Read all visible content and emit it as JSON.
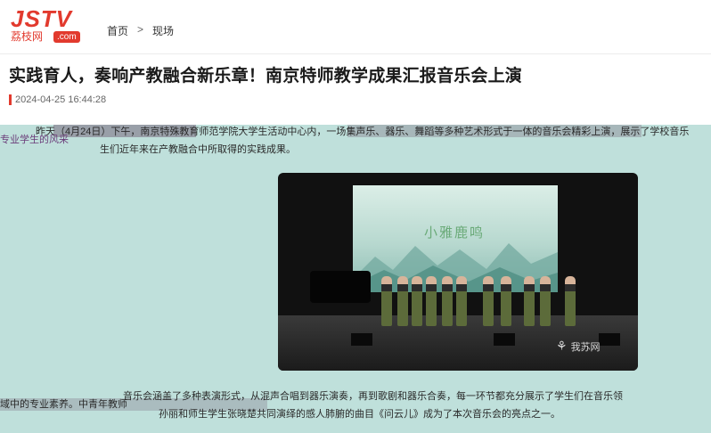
{
  "site": {
    "logo_main": "JSTV",
    "logo_sub": "荔枝网",
    "logo_com": ".com"
  },
  "breadcrumb": {
    "home": "首页",
    "separator": ">",
    "current": "现场"
  },
  "article": {
    "title": "实践育人，奏响产教融合新乐章！南京特师教学成果汇报音乐会上演",
    "datetime": "2024-04-25 16:44:28",
    "para1_line1": "昨天（4月24日）下午，南京特殊教育师范学院大学生活动中心内，一场集声乐、器乐、舞蹈等多种艺术形式于一体的音乐会精彩上演，展示了学校音乐",
    "para1_line2": "专业学生的风采",
    "para1_line3": "生们近年来在产教融合中所取得的实践成果。",
    "para2_line1": "音乐会涵盖了多种表演形式，从混声合唱到器乐演奏，再到歌剧和器乐合奏，每一环节都充分展示了学生们在音乐领",
    "para2_line2": "域中的专业素养。中青年教师",
    "para2_line3": "孙丽和师生学生张晓楚共同演绎的感人肺腑的曲目《问云儿》成为了本次音乐会的亮点之一。"
  },
  "photo": {
    "screen_title": "小雅鹿鸣",
    "watermark_text": "我苏网"
  },
  "colors": {
    "brand": "#e23a2e",
    "content_band": "#bfe0db"
  }
}
